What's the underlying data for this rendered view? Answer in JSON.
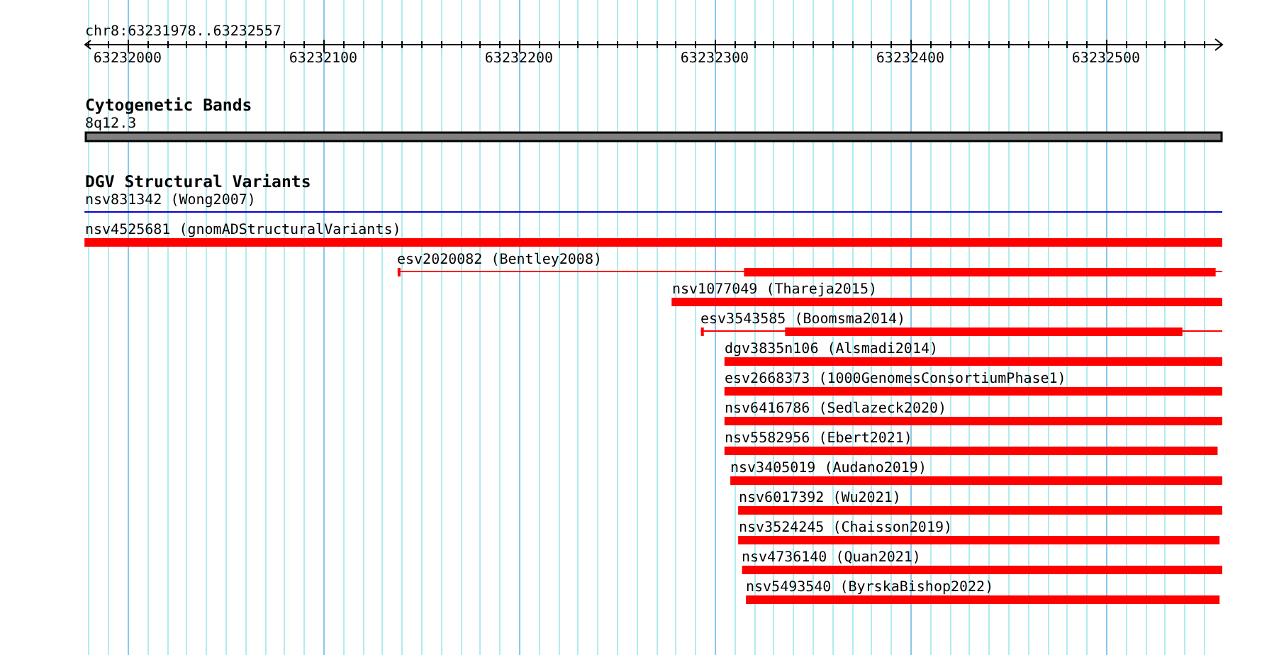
{
  "view": {
    "location": "chr8:63231978..63232557"
  },
  "ruler": {
    "labels": [
      "63232000",
      "63232100",
      "63232200",
      "63232300",
      "63232400",
      "63232500"
    ]
  },
  "cytogenetic_bands": {
    "title": "Cytogenetic Bands",
    "bands": [
      {
        "name": "8q12.3"
      }
    ]
  },
  "dgv_track": {
    "title": "DGV Structural Variants",
    "features": [
      {
        "label": "nsv831342 (Wong2007)",
        "kind": "line",
        "color": "#0000cc"
      },
      {
        "label": "nsv4525681 (gnomADStructuralVariants)",
        "kind": "block",
        "color": "#ff0000"
      },
      {
        "label": "esv2020082 (Bentley2008)",
        "kind": "gapped",
        "color": "#ff0000"
      },
      {
        "label": "nsv1077049 (Thareja2015)",
        "kind": "block",
        "color": "#ff0000"
      },
      {
        "label": "esv3543585 (Boomsma2014)",
        "kind": "gapped",
        "color": "#ff0000"
      },
      {
        "label": "dgv3835n106 (Alsmadi2014)",
        "kind": "block",
        "color": "#ff0000"
      },
      {
        "label": "esv2668373 (1000GenomesConsortiumPhase1)",
        "kind": "block",
        "color": "#ff0000"
      },
      {
        "label": "nsv6416786 (Sedlazeck2020)",
        "kind": "block",
        "color": "#ff0000"
      },
      {
        "label": "nsv5582956 (Ebert2021)",
        "kind": "block",
        "color": "#ff0000"
      },
      {
        "label": "nsv3405019 (Audano2019)",
        "kind": "block",
        "color": "#ff0000"
      },
      {
        "label": "nsv6017392 (Wu2021)",
        "kind": "block",
        "color": "#ff0000"
      },
      {
        "label": "nsv3524245 (Chaisson2019)",
        "kind": "block",
        "color": "#ff0000"
      },
      {
        "label": "nsv4736140 (Quan2021)",
        "kind": "block",
        "color": "#ff0000"
      },
      {
        "label": "nsv5493540 (ByrskaBishop2022)",
        "kind": "block",
        "color": "#ff0000"
      }
    ]
  }
}
